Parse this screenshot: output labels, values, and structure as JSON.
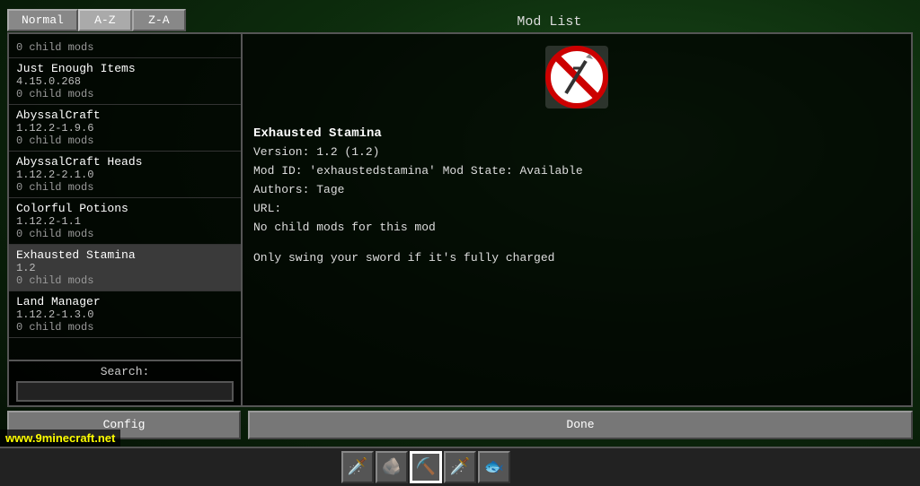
{
  "background": {
    "color": "#0d2d0d"
  },
  "header": {
    "title": "Mod List",
    "sort_buttons": [
      {
        "label": "Normal",
        "active": false
      },
      {
        "label": "A-Z",
        "active": true
      },
      {
        "label": "Z-A",
        "active": false
      }
    ]
  },
  "mod_list": {
    "items": [
      {
        "name": "",
        "version": "",
        "children": "0 child mods",
        "selected": false
      },
      {
        "name": "Just Enough Items",
        "version": "4.15.0.268",
        "children": "0 child mods",
        "selected": false
      },
      {
        "name": "AbyssalCraft",
        "version": "1.12.2-1.9.6",
        "children": "0 child mods",
        "selected": false
      },
      {
        "name": "AbyssalCraft Heads",
        "version": "1.12.2-2.1.0",
        "children": "0 child mods",
        "selected": false
      },
      {
        "name": "Colorful Potions",
        "version": "1.12.2-1.1",
        "children": "0 child mods",
        "selected": false
      },
      {
        "name": "Exhausted Stamina",
        "version": "1.2",
        "children": "0 child mods",
        "selected": true
      },
      {
        "name": "Land Manager",
        "version": "1.12.2-1.3.0",
        "children": "0 child mods",
        "selected": false
      }
    ]
  },
  "search": {
    "label": "Search:",
    "placeholder": "",
    "value": ""
  },
  "detail": {
    "mod_name": "Exhausted Stamina",
    "version_line": "Version: 1.2 (1.2)",
    "mod_id_line": "Mod ID: 'exhaustedstamina'  Mod State: Available",
    "authors_line": "Authors: Tage",
    "url_line": "URL:",
    "children_line": "No child mods for this mod",
    "description": "Only swing your sword if it's fully charged"
  },
  "buttons": {
    "config": "Config",
    "done": "Done"
  },
  "watermark": {
    "text": "www.9minecraft.net"
  },
  "hotbar": {
    "slots": [
      "🗡",
      "🪨",
      "⛏",
      "🗡",
      "🐟"
    ]
  }
}
